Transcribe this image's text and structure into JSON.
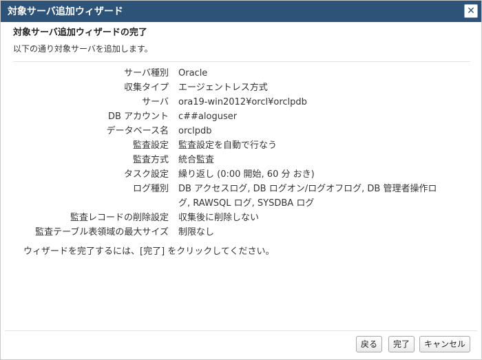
{
  "window": {
    "title": "対象サーバ追加ウィザード"
  },
  "heading": "対象サーバ追加ウィザードの完了",
  "subheading": "以下の通り対象サーバを追加します。",
  "summary": [
    {
      "label": "サーバ種別",
      "value": "Oracle"
    },
    {
      "label": "収集タイプ",
      "value": "エージェントレス方式"
    },
    {
      "label": "サーバ",
      "value": "ora19-win2012¥orcl¥orclpdb"
    },
    {
      "label": "DB アカウント",
      "value": "c##aloguser"
    },
    {
      "label": "データベース名",
      "value": "orclpdb"
    },
    {
      "label": "監査設定",
      "value": "監査設定を自動で行なう"
    },
    {
      "label": "監査方式",
      "value": "統合監査"
    },
    {
      "label": "タスク設定",
      "value": "繰り返し (0:00 開始, 60 分 おき)"
    },
    {
      "label": "ログ種別",
      "value_line1": "DB アクセスログ, DB ログオン/ログオフログ, DB 管理者操作ロ",
      "value_line2": "グ, RAWSQL ログ, SYSDBA ログ"
    },
    {
      "label": "監査レコードの削除設定",
      "value": "収集後に削除しない"
    },
    {
      "label": "監査テーブル表領域の最大サイズ",
      "value": "制限なし"
    }
  ],
  "instruction": "ウィザードを完了するには、[完了] をクリックしてください。",
  "buttons": {
    "back": "戻る",
    "finish": "完了",
    "cancel": "キャンセル"
  },
  "icons": {
    "close": "close-icon"
  },
  "colors": {
    "titlebar": "#2e5379",
    "title_text": "#ffffff"
  }
}
